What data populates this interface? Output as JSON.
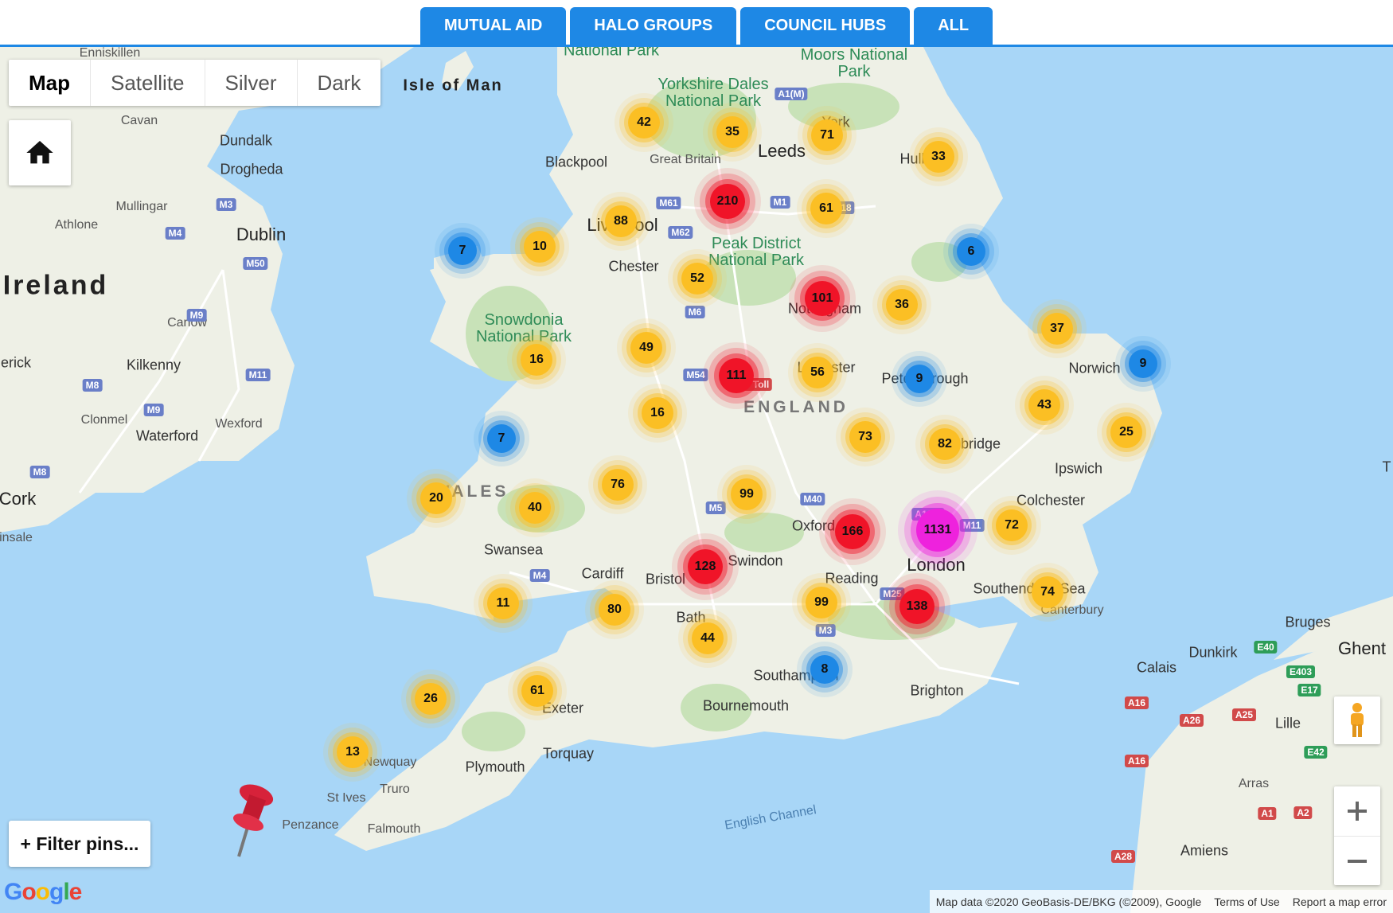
{
  "tabs": [
    "MUTUAL AID",
    "HALO GROUPS",
    "COUNCIL HUBS",
    "ALL"
  ],
  "map_types": [
    "Map",
    "Satellite",
    "Silver",
    "Dark"
  ],
  "active_map_type": "Map",
  "filter_button": "+ Filter pins...",
  "footer": {
    "map_data": "Map data ©2020 GeoBasis-DE/BKG (©2009), Google",
    "terms": "Terms of Use",
    "report": "Report a map error"
  },
  "logo": {
    "letters": [
      "G",
      "o",
      "o",
      "g",
      "l",
      "e"
    ],
    "colors": [
      "#4285f4",
      "#ea4335",
      "#fbbc05",
      "#4285f4",
      "#34a853",
      "#ea4335"
    ]
  },
  "colors": {
    "yellow": "#fbbf24",
    "blue": "#1e88e5",
    "red": "#f01428",
    "pink": "#ee22dd",
    "sea": "#a8d6f7",
    "land": "#eef0e6"
  },
  "places": {
    "enniskillen": "Enniskillen",
    "cavan": "Cavan",
    "dundalk": "Dundalk",
    "drogheda": "Drogheda",
    "mullingar": "Mullingar",
    "athlone": "Athlone",
    "dublin": "Dublin",
    "ireland": "Ireland",
    "carlow": "Carlow",
    "kilkenny": "Kilkenny",
    "erick": "erick",
    "clonmel": "Clonmel",
    "waterford": "Waterford",
    "wexford": "Wexford",
    "cork": "Cork",
    "insale": "insale",
    "isle_of_man": "Isle of Man",
    "national_park_top": "National Park",
    "yorkshire_dales": "Yorkshire Dales National Park",
    "moors": "Moors National Park",
    "york": "York",
    "leeds": "Leeds",
    "hull": "Hull",
    "blackpool": "Blackpool",
    "great_britain": "Great Britain",
    "liverpool": "Liverpool",
    "chester": "Chester",
    "peak_district": "Peak District National Park",
    "snowdonia": "Snowdonia National Park",
    "nottingham": "Nottingham",
    "leicester": "Leicester",
    "peterborough": "Peterborough",
    "norwich": "Norwich",
    "cambridge": "Cambridge",
    "ipswich": "Ipswich",
    "colchester": "Colchester",
    "england": "ENGLAND",
    "wales": "WALES",
    "oxford": "Oxford",
    "swindon": "Swindon",
    "swansea": "Swansea",
    "cardiff": "Cardiff",
    "bristol": "Bristol",
    "bath": "Bath",
    "reading": "Reading",
    "london": "London",
    "southend": "Southend-on-Sea",
    "canterbury": "Canterbury",
    "southampton": "Southampton",
    "brighton": "Brighton",
    "bournemouth": "Bournemouth",
    "exeter": "Exeter",
    "torquay": "Torquay",
    "plymouth": "Plymouth",
    "newquay": "Newquay",
    "truro": "Truro",
    "st_ives": "St Ives",
    "penzance": "Penzance",
    "falmouth": "Falmouth",
    "english_channel": "English Channel",
    "bruges": "Bruges",
    "ghent": "Ghent",
    "dunkirk": "Dunkirk",
    "calais": "Calais",
    "lille": "Lille",
    "arras": "Arras",
    "amiens": "Amiens",
    "t": "T"
  },
  "roads": {
    "m3": "M3",
    "m4_ie": "M4",
    "m50": "M50",
    "m9_a": "M9",
    "m11": "M11",
    "m8_a": "M8",
    "m9_b": "M9",
    "m8_b": "M8",
    "a1m_n": "A1(M)",
    "m61": "M61",
    "m1": "M1",
    "a18": "18",
    "m62": "M62",
    "m6": "M6",
    "m54": "M54",
    "m6toll": "M6 Toll",
    "m40": "M40",
    "m5": "M5",
    "a1m_s": "A1(M)",
    "m11_uk": "M11",
    "m4_uk": "M4",
    "m25": "M25",
    "m3_uk": "M3",
    "e40": "E40",
    "e403": "E403",
    "e17": "E17",
    "a16_a": "A16",
    "a26": "A26",
    "a25": "A25",
    "a16_b": "A16",
    "e42": "E42",
    "a1": "A1",
    "a2": "A2",
    "a28": "A28"
  },
  "clusters": [
    {
      "id": "c42",
      "label": "42",
      "count": 42,
      "color": "yellow"
    },
    {
      "id": "c35",
      "label": "35",
      "count": 35,
      "color": "yellow"
    },
    {
      "id": "c71",
      "label": "71",
      "count": 71,
      "color": "yellow"
    },
    {
      "id": "c33",
      "label": "33",
      "count": 33,
      "color": "yellow"
    },
    {
      "id": "c210",
      "label": "210",
      "count": 210,
      "color": "red"
    },
    {
      "id": "c61a",
      "label": "61",
      "count": 61,
      "color": "yellow"
    },
    {
      "id": "c88",
      "label": "88",
      "count": 88,
      "color": "yellow"
    },
    {
      "id": "c7a",
      "label": "7",
      "count": 7,
      "color": "blue"
    },
    {
      "id": "c10",
      "label": "10",
      "count": 10,
      "color": "yellow"
    },
    {
      "id": "c6",
      "label": "6",
      "count": 6,
      "color": "blue"
    },
    {
      "id": "c52",
      "label": "52",
      "count": 52,
      "color": "yellow"
    },
    {
      "id": "c101",
      "label": "101",
      "count": 101,
      "color": "red"
    },
    {
      "id": "c36",
      "label": "36",
      "count": 36,
      "color": "yellow"
    },
    {
      "id": "c37",
      "label": "37",
      "count": 37,
      "color": "yellow"
    },
    {
      "id": "c49",
      "label": "49",
      "count": 49,
      "color": "yellow"
    },
    {
      "id": "c16a",
      "label": "16",
      "count": 16,
      "color": "yellow"
    },
    {
      "id": "c111",
      "label": "111",
      "count": 111,
      "color": "red"
    },
    {
      "id": "c56",
      "label": "56",
      "count": 56,
      "color": "yellow"
    },
    {
      "id": "c9a",
      "label": "9",
      "count": 9,
      "color": "blue"
    },
    {
      "id": "c9b",
      "label": "9",
      "count": 9,
      "color": "blue"
    },
    {
      "id": "c43",
      "label": "43",
      "count": 43,
      "color": "yellow"
    },
    {
      "id": "c16b",
      "label": "16",
      "count": 16,
      "color": "yellow"
    },
    {
      "id": "c25",
      "label": "25",
      "count": 25,
      "color": "yellow"
    },
    {
      "id": "c7b",
      "label": "7",
      "count": 7,
      "color": "blue"
    },
    {
      "id": "c73",
      "label": "73",
      "count": 73,
      "color": "yellow"
    },
    {
      "id": "c82",
      "label": "82",
      "count": 82,
      "color": "yellow"
    },
    {
      "id": "c76",
      "label": "76",
      "count": 76,
      "color": "yellow"
    },
    {
      "id": "c20",
      "label": "20",
      "count": 20,
      "color": "yellow"
    },
    {
      "id": "c40",
      "label": "40",
      "count": 40,
      "color": "yellow"
    },
    {
      "id": "c99a",
      "label": "99",
      "count": 99,
      "color": "yellow"
    },
    {
      "id": "c166",
      "label": "166",
      "count": 166,
      "color": "red"
    },
    {
      "id": "c1131",
      "label": "1131",
      "count": 1131,
      "color": "pink"
    },
    {
      "id": "c72",
      "label": "72",
      "count": 72,
      "color": "yellow"
    },
    {
      "id": "c128",
      "label": "128",
      "count": 128,
      "color": "red"
    },
    {
      "id": "c11",
      "label": "11",
      "count": 11,
      "color": "yellow"
    },
    {
      "id": "c80",
      "label": "80",
      "count": 80,
      "color": "yellow"
    },
    {
      "id": "c99b",
      "label": "99",
      "count": 99,
      "color": "yellow"
    },
    {
      "id": "c138",
      "label": "138",
      "count": 138,
      "color": "red"
    },
    {
      "id": "c74",
      "label": "74",
      "count": 74,
      "color": "yellow"
    },
    {
      "id": "c44",
      "label": "44",
      "count": 44,
      "color": "yellow"
    },
    {
      "id": "c8",
      "label": "8",
      "count": 8,
      "color": "blue"
    },
    {
      "id": "c26",
      "label": "26",
      "count": 26,
      "color": "yellow"
    },
    {
      "id": "c61b",
      "label": "61",
      "count": 61,
      "color": "yellow"
    },
    {
      "id": "c13",
      "label": "13",
      "count": 13,
      "color": "yellow"
    }
  ]
}
